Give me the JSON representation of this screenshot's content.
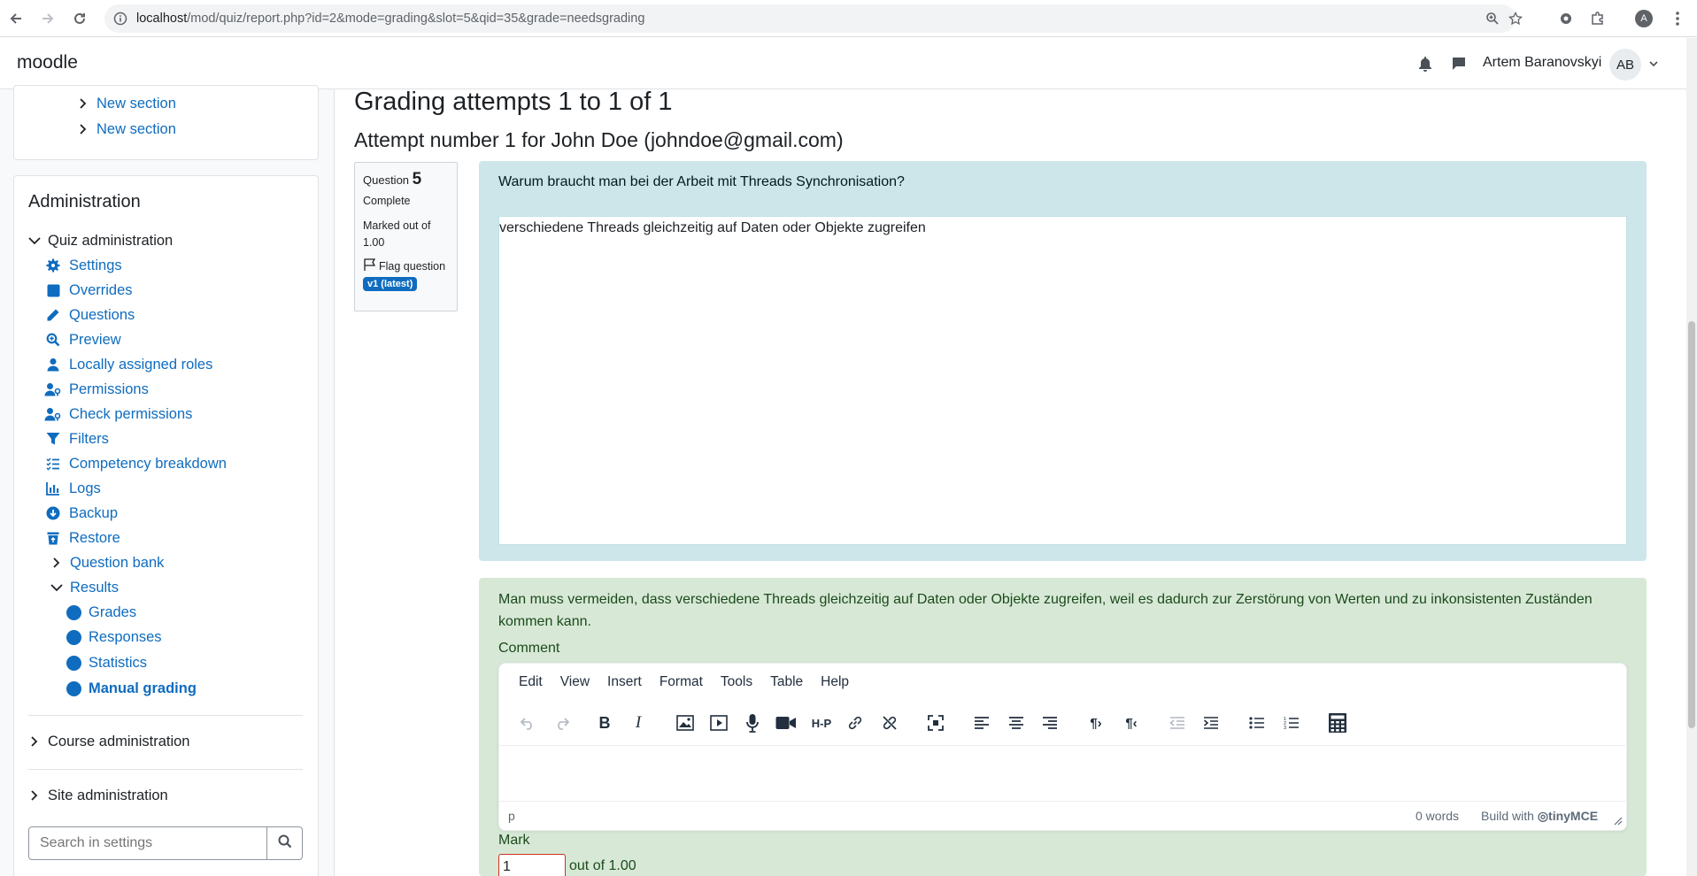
{
  "browser": {
    "url_host": "localhost",
    "url_path": "/mod/quiz/report.php?id=2&mode=grading&slot=5&qid=35&grade=needsgrading",
    "profile_initial": "A"
  },
  "navbar": {
    "brand": "moodle",
    "user_name": "Artem Baranovskyi",
    "avatar_initials": "AB"
  },
  "sidebar": {
    "sections": [
      "New section",
      "New section"
    ],
    "admin_title": "Administration",
    "quiz_admin_label": "Quiz administration",
    "quiz_admin_items": [
      {
        "label": "Settings",
        "icon": "gear-icon"
      },
      {
        "label": "Overrides",
        "icon": "square-icon"
      },
      {
        "label": "Questions",
        "icon": "pencil-icon"
      },
      {
        "label": "Preview",
        "icon": "magnify-icon"
      },
      {
        "label": "Locally assigned roles",
        "icon": "user-icon"
      },
      {
        "label": "Permissions",
        "icon": "user-key-icon"
      },
      {
        "label": "Check permissions",
        "icon": "user-key-icon"
      },
      {
        "label": "Filters",
        "icon": "funnel-icon"
      },
      {
        "label": "Competency breakdown",
        "icon": "list-check-icon"
      },
      {
        "label": "Logs",
        "icon": "bar-chart-icon"
      },
      {
        "label": "Backup",
        "icon": "download-circle-icon"
      },
      {
        "label": "Restore",
        "icon": "trash-restore-icon"
      }
    ],
    "question_bank_label": "Question bank",
    "results_label": "Results",
    "results_items": [
      "Grades",
      "Responses",
      "Statistics",
      "Manual grading"
    ],
    "course_admin_label": "Course administration",
    "site_admin_label": "Site administration",
    "search_placeholder": "Search in settings"
  },
  "main": {
    "title": "Grading attempts 1 to 1 of 1",
    "attempt_heading": "Attempt number 1 for John Doe (johndoe@gmail.com)",
    "qinfo": {
      "question_label": "Question",
      "question_number": "5",
      "state": "Complete",
      "marked_out_of": "Marked out of 1.00",
      "flag_label": "Flag question",
      "version_badge": "v1 (latest)"
    },
    "question_text": "Warum braucht man bei der Arbeit mit Threads Synchronisation?",
    "answer_text": "verschiedene Threads gleichzeitig auf Daten oder Objekte zugreifen",
    "right_answer": "Man muss vermeiden, dass verschiedene Threads gleichzeitig auf Daten oder Objekte zugreifen, weil es dadurch zur Zerstörung von Werten und zu inkonsistenten Zuständen kommen kann.",
    "comment_label": "Comment",
    "editor": {
      "menu": [
        "Edit",
        "View",
        "Insert",
        "Format",
        "Tools",
        "Table",
        "Help"
      ],
      "status_path": "p",
      "word_count": "0 words",
      "build_with": "Build with",
      "tiny_brand": "tinyMCE"
    },
    "mark_label": "Mark",
    "mark_value": "1",
    "mark_out_of": "out of 1.00"
  },
  "colors": {
    "link": "#0f6cbf",
    "formulation_bg": "#cce6ea",
    "outcome_bg": "#d7e9d6",
    "invalid_border": "#ca3120"
  }
}
